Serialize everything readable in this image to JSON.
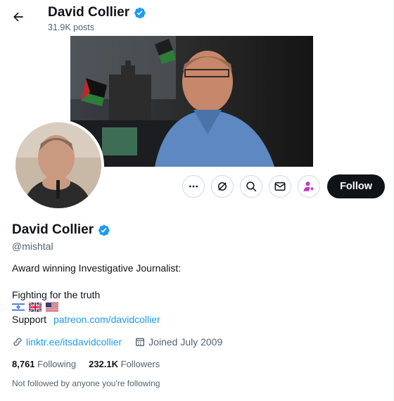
{
  "header": {
    "name": "David Collier",
    "posts": "31.9K posts"
  },
  "actions": {
    "follow_label": "Follow"
  },
  "profile": {
    "name": "David Collier",
    "handle": "@mishtal",
    "bio_line1": "Award winning Investigative Journalist:",
    "bio_line2": "",
    "bio_line3": "Fighting for the truth",
    "support_label": "Support",
    "support_link": "patreon.com/davidcollier",
    "website": "linktr.ee/itsdavidcollier",
    "joined": "Joined July 2009"
  },
  "stats": {
    "following_count": "8,761",
    "following_label": "Following",
    "followers_count": "232.1K",
    "followers_label": "Followers"
  },
  "footer": {
    "not_followed": "Not followed by anyone you're following"
  },
  "icons": {
    "back": "arrow-left-icon",
    "more": "more-icon",
    "grok": "grok-icon",
    "search": "search-icon",
    "message": "mail-icon",
    "subscribe": "person-star-icon",
    "link": "link-icon",
    "calendar": "calendar-icon"
  },
  "colors": {
    "accent": "#1d9bf0",
    "text": "#0f1419",
    "muted": "#536471",
    "follow_bg": "#0f1419",
    "subscribe_accent": "#c13ac6"
  }
}
